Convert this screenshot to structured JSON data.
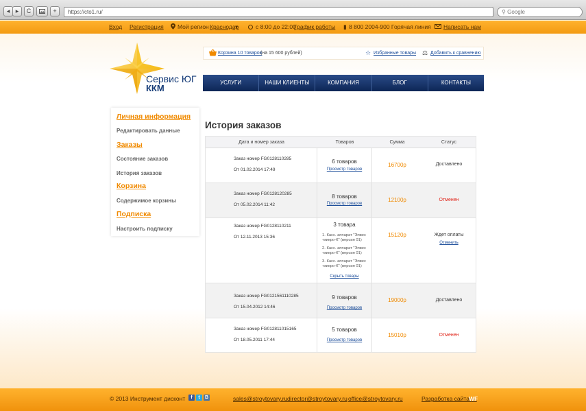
{
  "browser": {
    "url": "https://cto1.ru/",
    "search_placeholder": "Google",
    "back_icon": "◂",
    "forward_icon": "▸",
    "reload_icon": "C",
    "add_icon": "+"
  },
  "topbar": {
    "login": "Вход",
    "register": "Регистрация",
    "region_label": "Мой регион",
    "region_value": "Краснодар",
    "hours": "с 8:00 до 22:00",
    "schedule_link": "График работы",
    "hotline": "8 800 2004-900 Горячая линия",
    "write_us": "Написать нам"
  },
  "logo": {
    "line1": "Сервис ЮГ",
    "line2": "ККМ"
  },
  "cart": {
    "link": "Корзина 10 товаров",
    "sum": "(на 15 600 рублей)",
    "favorites": "Избранные товары",
    "compare": "Добавить к сравнению"
  },
  "menu": [
    "УСЛУГИ",
    "НАШИ КЛИЕНТЫ",
    "КОМПАНИЯ",
    "БЛОГ",
    "КОНТАКТЫ"
  ],
  "sidebar": {
    "h1": "Личная информация",
    "i1": "Редактировать данные",
    "h2": "Заказы",
    "i2": "Состояние заказов",
    "i3": "История заказов",
    "h3": "Корзина",
    "i4": "Содержимое корзины",
    "h4": "Подписка",
    "i5": "Настроить подписку"
  },
  "page_title": "История заказов",
  "table": {
    "headers": [
      "Дата и номер заказа",
      "Товаров",
      "Сумма",
      "Статус"
    ],
    "view_link": "Просмотр товаров",
    "hide_link": "Скрыть товары",
    "cancel_link": "Отменить",
    "rows": [
      {
        "order": "Заказ номер FG0128110285",
        "date": "От 01.02.2014 17:49",
        "count": "6 товаров",
        "sum": "16700р",
        "status": "Доставлено"
      },
      {
        "order": "Заказ номер FG0128120285",
        "date": "От 05.02.2014 11:42",
        "count": "8 товаров",
        "sum": "12100р",
        "status": "Отменен"
      },
      {
        "order": "Заказ номер FG0128110211",
        "date": "От 12.11.2013 15:36",
        "count": "3 товара",
        "sum": "15120р",
        "status": "Ждет оплаты",
        "items": [
          "1. Касс. аппарат \"Элвес -микро-К\" (версия 01)",
          "2. Касс. аппарат \"Элвес -микро-К\" (версия 01)",
          "3. Касс. аппарат \"Элвес -микро-К\" (версия 01)"
        ]
      },
      {
        "order": "Заказ номер FG0121561110285",
        "date": "От 15.04.2012 14:46",
        "count": "9 товаров",
        "sum": "19000р",
        "status": "Доставлено"
      },
      {
        "order": "Заказ номер FG012811015165",
        "date": "От 18.05.2011 17:44",
        "count": "5 товаров",
        "sum": "15010р",
        "status": "Отменен"
      }
    ]
  },
  "footer": {
    "copyright": "© 2013 Инструмент дисконт",
    "social": [
      "f",
      "t",
      "В"
    ],
    "email1": "sales@stroytovary.ru",
    "email2": "director@stroytovary.ru",
    "email3": "office@stroytovary.ru",
    "dev_label": "Разработка сайта —",
    "dev_name": "WF"
  },
  "colors": {
    "orange": "#f39a12",
    "navy": "#0d2656",
    "accent": "#f08a00",
    "link": "#1d4e9a",
    "red": "#e0261b"
  }
}
